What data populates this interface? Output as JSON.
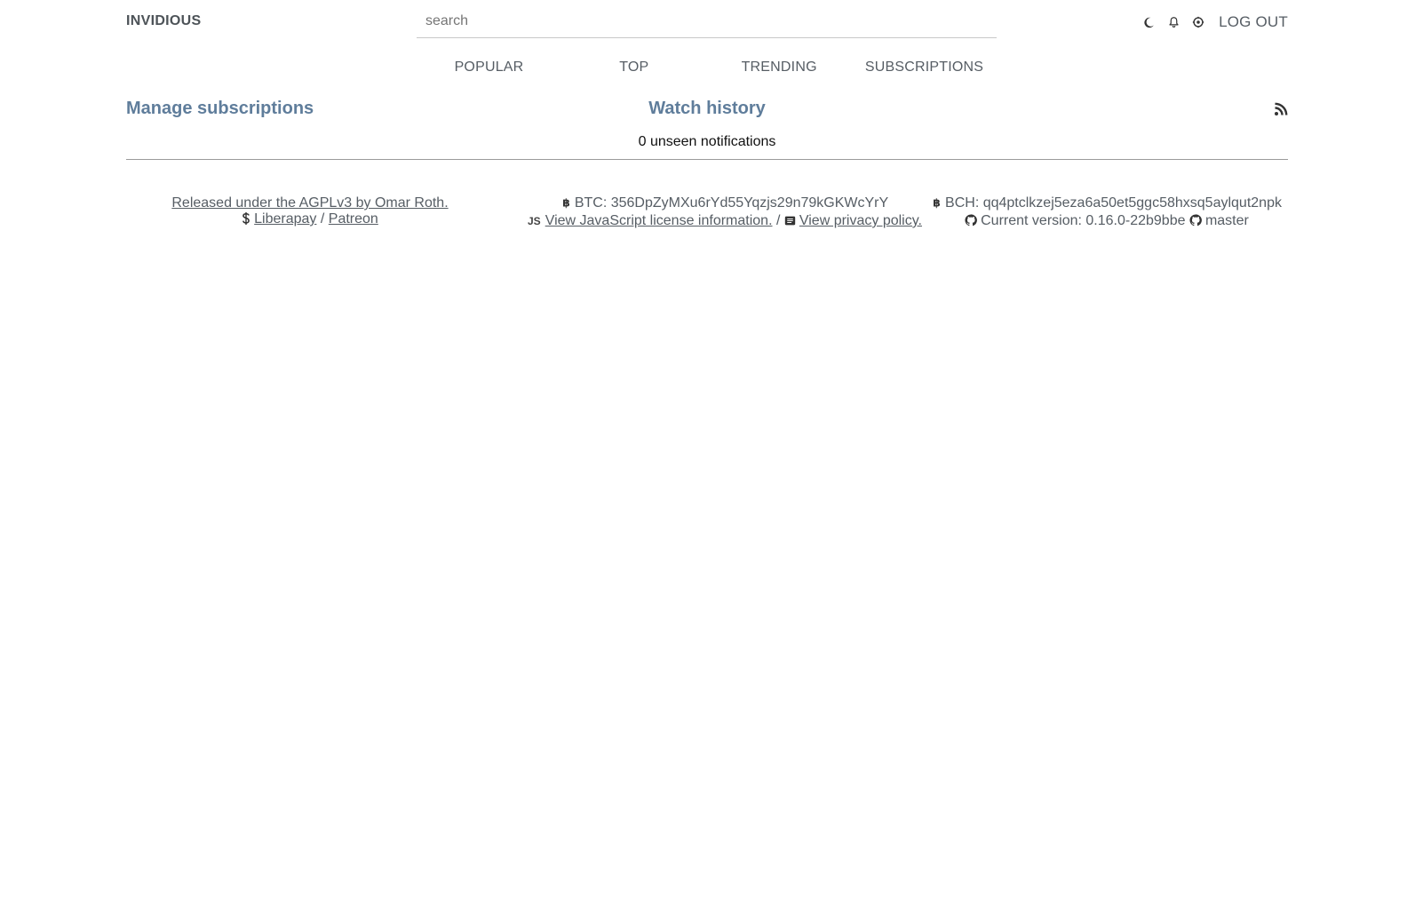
{
  "navbar": {
    "brand": "INVIDIOUS",
    "search_placeholder": "search",
    "logout_label": "LOG OUT",
    "icons": [
      "moon-icon",
      "bell-icon",
      "settings-icon"
    ]
  },
  "feed_menu": {
    "items": [
      {
        "label": "POPULAR"
      },
      {
        "label": "TOP"
      },
      {
        "label": "TRENDING"
      },
      {
        "label": "SUBSCRIPTIONS"
      }
    ]
  },
  "subscriptions": {
    "manage_label": "Manage subscriptions",
    "history_label": "Watch history",
    "rss_icon": "rss-icon",
    "notifications": "0 unseen notifications"
  },
  "footer": {
    "license_text": "Released under the AGPLv3 by Omar Roth.",
    "donate_liberapay": "Liberapay",
    "donate_separator": " / ",
    "donate_patreon": "Patreon",
    "btc": "BTC: 356DpZyMXu6rYd55Yqzjs29n79kGKWcYrY",
    "js_icon_label": "JS",
    "js_license": "View JavaScript license information.",
    "policy_separator": " / ",
    "privacy": "View privacy policy.",
    "bch": "BCH: qq4ptclkzej5eza6a50et5ggc58hxsq5aylqut2npk",
    "version": "Current version: 0.16.0-22b9bbe",
    "branch": "master"
  },
  "colors": {
    "text": "#565d64",
    "link_heading": "#5f7d9b",
    "divider": "#9a9a9a",
    "background": "#ffffff"
  }
}
